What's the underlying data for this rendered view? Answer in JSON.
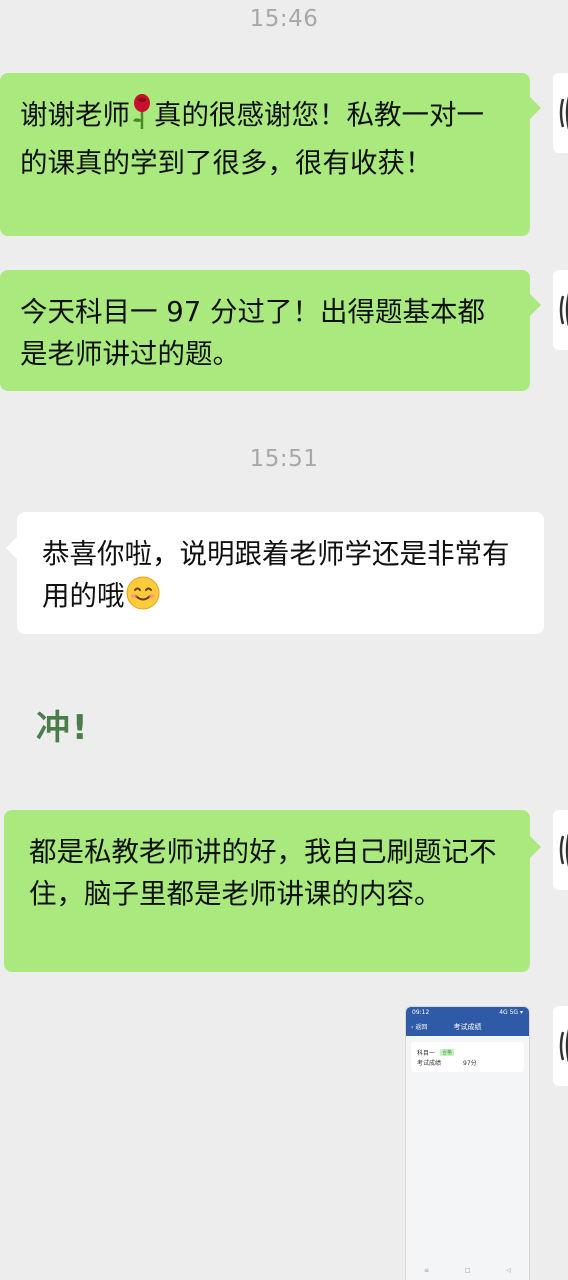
{
  "timestamps": [
    "15:46",
    "15:51"
  ],
  "messages": [
    {
      "side": "out",
      "text_before": "谢谢老师",
      "emoji": "rose",
      "text_after": "真的很感谢您！私教一对一的课真的学到了很多，很有收获！"
    },
    {
      "side": "out",
      "text": "今天科目一 97 分过了！出得题基本都是老师讲过的题。"
    },
    {
      "side": "in",
      "text": "恭喜你啦，说明跟着老师学还是非常有用的哦",
      "emoji": "smile"
    },
    {
      "side": "in",
      "sticker_text": "冲!"
    },
    {
      "side": "out",
      "text": "都是私教老师讲的好，我自己刷题记不住，脑子里都是老师讲课的内容。"
    }
  ],
  "screenshot_thumb": {
    "status_time": "09:12",
    "status_icons": "4G 5G ▾",
    "back_label": "返回",
    "title": "考试成绩",
    "subject": "科目一",
    "tag": "合格",
    "score_label": "考试成绩",
    "score": "97分"
  },
  "colors": {
    "outgoing_bubble": "#a9e97d",
    "incoming_bubble": "#ffffff",
    "background": "#ededed"
  }
}
